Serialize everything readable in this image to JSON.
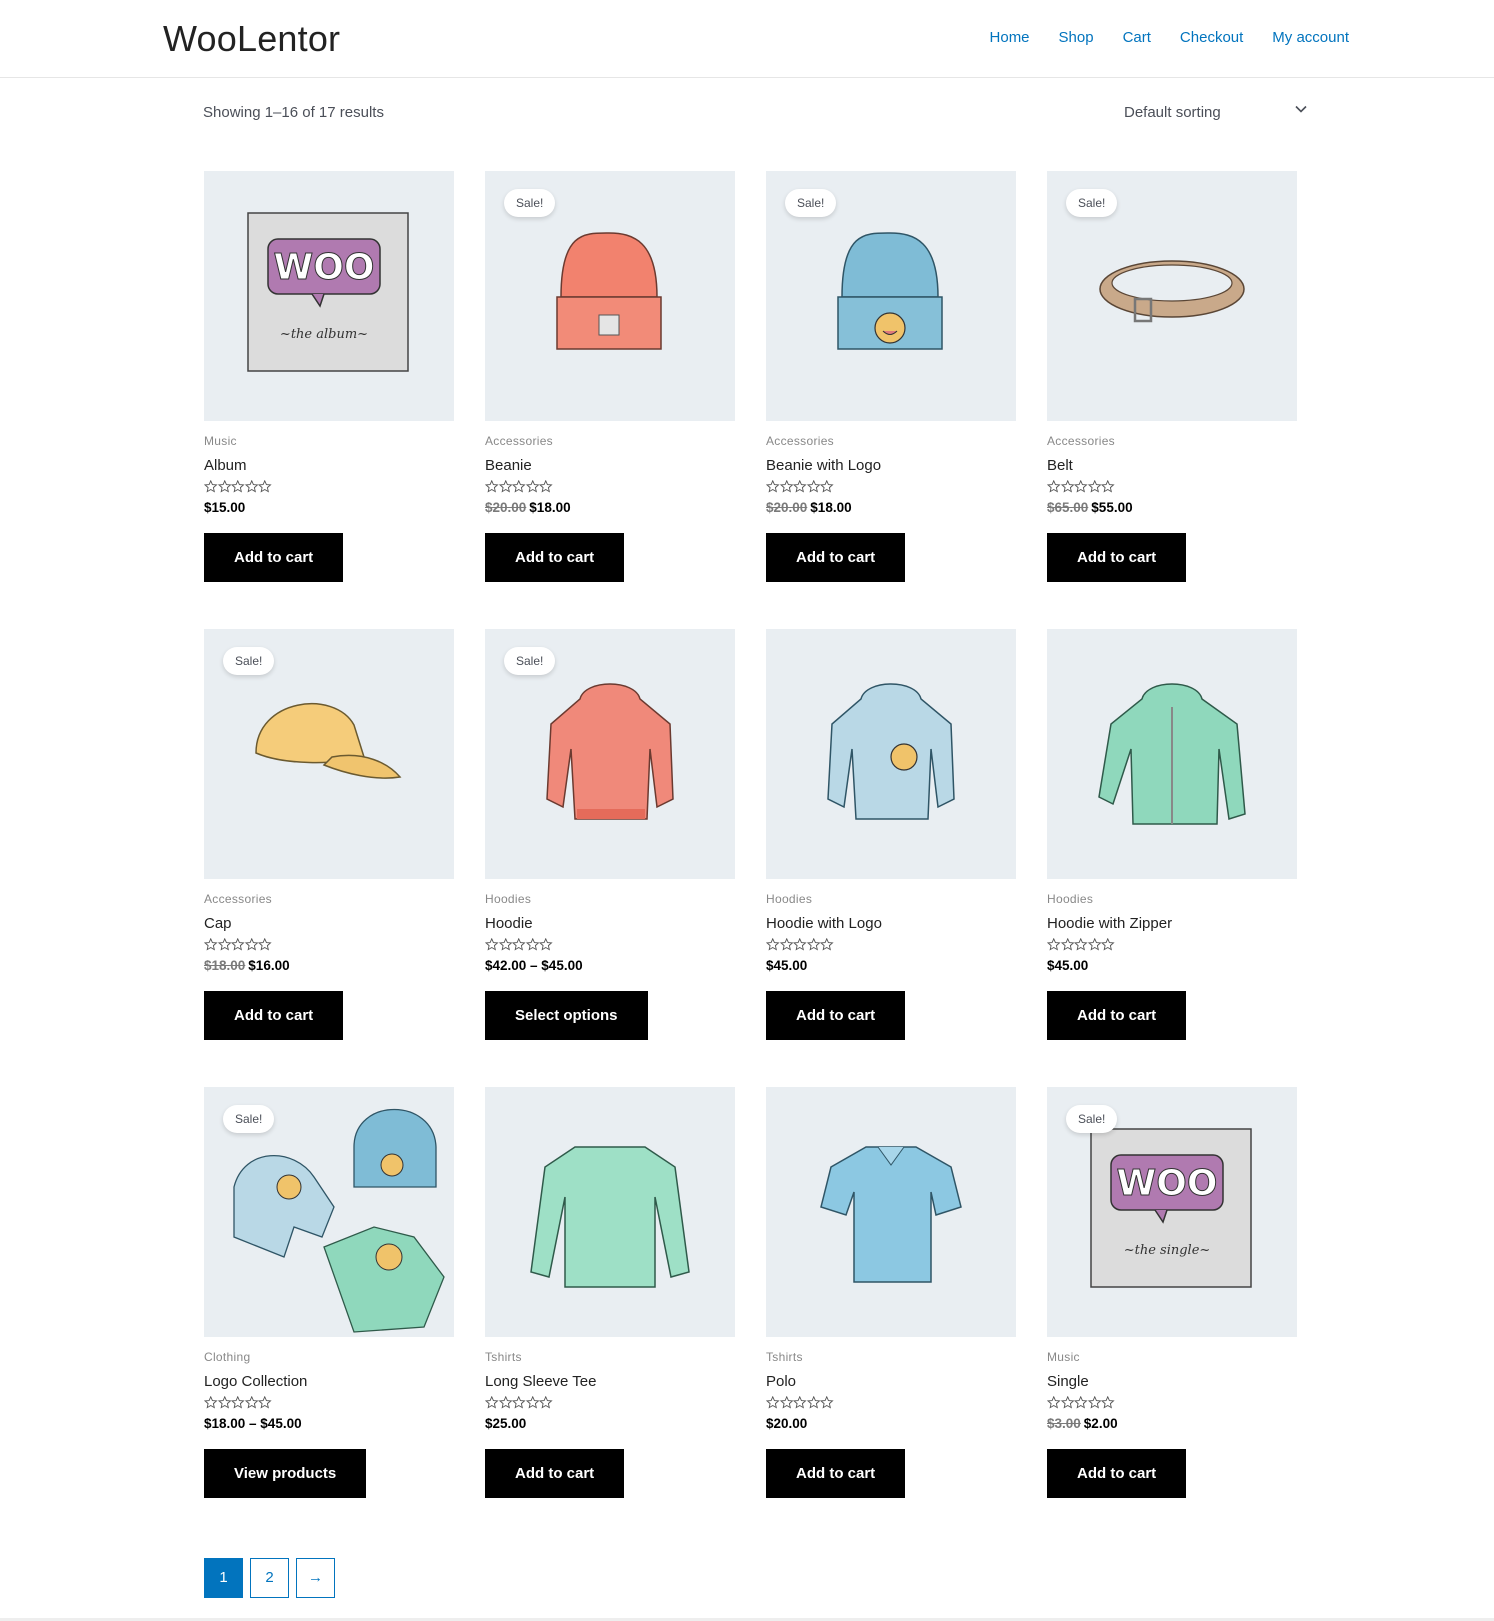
{
  "site": {
    "title": "WooLentor"
  },
  "nav": [
    {
      "label": "Home"
    },
    {
      "label": "Shop"
    },
    {
      "label": "Cart"
    },
    {
      "label": "Checkout"
    },
    {
      "label": "My account"
    }
  ],
  "toolbar": {
    "result_count": "Showing 1–16 of 17 results",
    "sorting_selected": "Default sorting"
  },
  "colors": {
    "accent": "#0274be",
    "button_bg": "#000000",
    "thumb_bg": "#e9eef2"
  },
  "products": [
    {
      "category": "Music",
      "title": "Album",
      "rating": 0,
      "price_regular": "",
      "price": "$15.00",
      "sale": false,
      "button": "Add to cart",
      "image": "album"
    },
    {
      "category": "Accessories",
      "title": "Beanie",
      "rating": 0,
      "price_regular": "$20.00",
      "price": "$18.00",
      "sale": true,
      "button": "Add to cart",
      "image": "beanie-red"
    },
    {
      "category": "Accessories",
      "title": "Beanie with Logo",
      "rating": 0,
      "price_regular": "$20.00",
      "price": "$18.00",
      "sale": true,
      "button": "Add to cart",
      "image": "beanie-blue"
    },
    {
      "category": "Accessories",
      "title": "Belt",
      "rating": 0,
      "price_regular": "$65.00",
      "price": "$55.00",
      "sale": true,
      "button": "Add to cart",
      "image": "belt"
    },
    {
      "category": "Accessories",
      "title": "Cap",
      "rating": 0,
      "price_regular": "$18.00",
      "price": "$16.00",
      "sale": true,
      "button": "Add to cart",
      "image": "cap"
    },
    {
      "category": "Hoodies",
      "title": "Hoodie",
      "rating": 0,
      "price_regular": "",
      "price": "$42.00 – $45.00",
      "sale": true,
      "button": "Select options",
      "image": "hoodie-red"
    },
    {
      "category": "Hoodies",
      "title": "Hoodie with Logo",
      "rating": 0,
      "price_regular": "",
      "price": "$45.00",
      "sale": false,
      "button": "Add to cart",
      "image": "hoodie-blue"
    },
    {
      "category": "Hoodies",
      "title": "Hoodie with Zipper",
      "rating": 0,
      "price_regular": "",
      "price": "$45.00",
      "sale": false,
      "button": "Add to cart",
      "image": "hoodie-green"
    },
    {
      "category": "Clothing",
      "title": "Logo Collection",
      "rating": 0,
      "price_regular": "",
      "price": "$18.00 – $45.00",
      "sale": true,
      "button": "View products",
      "image": "collection"
    },
    {
      "category": "Tshirts",
      "title": "Long Sleeve Tee",
      "rating": 0,
      "price_regular": "",
      "price": "$25.00",
      "sale": false,
      "button": "Add to cart",
      "image": "longsleeve"
    },
    {
      "category": "Tshirts",
      "title": "Polo",
      "rating": 0,
      "price_regular": "",
      "price": "$20.00",
      "sale": false,
      "button": "Add to cart",
      "image": "polo"
    },
    {
      "category": "Music",
      "title": "Single",
      "rating": 0,
      "price_regular": "$3.00",
      "price": "$2.00",
      "sale": true,
      "button": "Add to cart",
      "image": "single"
    }
  ],
  "sale_label": "Sale!",
  "pagination": {
    "pages": [
      "1",
      "2"
    ],
    "current": "1",
    "next": "→"
  }
}
